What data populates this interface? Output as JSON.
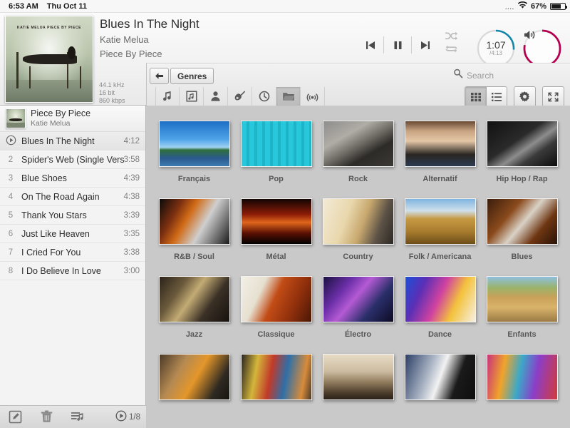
{
  "statusbar": {
    "time": "6:53 AM",
    "date": "Thu Oct 11",
    "signal_dots": "....",
    "wifi_icon": "wifi-icon",
    "battery_percent": "67%"
  },
  "player": {
    "cover_caption": "KATIE MELUA  PIECE BY PIECE",
    "song": "Blues In The Night",
    "artist": "Katie Melua",
    "album": "Piece By Piece",
    "tech": {
      "sample_rate": "44.1 kHz",
      "bit_depth": "16 bit",
      "bitrate": "860 kbps"
    },
    "transport": {
      "previous": "previous-track-icon",
      "play_pause": "pause-icon",
      "next": "next-track-icon",
      "shuffle": "shuffle-icon",
      "repeat": "repeat-icon"
    },
    "progress": {
      "elapsed": "1:07",
      "total": "/4:13",
      "percent": 26,
      "color": "#1387a8"
    },
    "volume": {
      "icon": "speaker-icon",
      "percent": 78,
      "color": "#b3004f"
    }
  },
  "library_toolbar": {
    "back_icon": "back-arrow-icon",
    "breadcrumb": "Genres",
    "search": {
      "icon": "search-icon",
      "placeholder": "Search",
      "value": ""
    },
    "categories": [
      {
        "name": "songs",
        "icon": "music-note-icon",
        "active": false
      },
      {
        "name": "albums",
        "icon": "album-art-icon",
        "active": false
      },
      {
        "name": "artists",
        "icon": "person-icon",
        "active": false
      },
      {
        "name": "composers",
        "icon": "guitar-icon",
        "active": false
      },
      {
        "name": "recent",
        "icon": "clock-icon",
        "active": false
      },
      {
        "name": "genres",
        "icon": "folder-icon",
        "active": true
      },
      {
        "name": "radio",
        "icon": "broadcast-icon",
        "active": false
      }
    ],
    "view_buttons": [
      {
        "name": "grid-view",
        "icon": "grid-icon",
        "active": true
      },
      {
        "name": "list-view",
        "icon": "list-icon",
        "active": false
      }
    ],
    "settings_icon": "gear-icon",
    "fullscreen_icon": "fullscreen-icon"
  },
  "sidebar": {
    "header": {
      "title": "Piece By Piece",
      "artist": "Katie Melua",
      "thumb": "album-thumbnail"
    },
    "tracks": [
      {
        "num": "1",
        "playing": true,
        "name": "Blues In The Night",
        "duration": "4:12"
      },
      {
        "num": "2",
        "playing": false,
        "name": "Spider's Web (Single Version)",
        "duration": "3:58"
      },
      {
        "num": "3",
        "playing": false,
        "name": "Blue Shoes",
        "duration": "4:39"
      },
      {
        "num": "4",
        "playing": false,
        "name": "On The Road Again",
        "duration": "4:38"
      },
      {
        "num": "5",
        "playing": false,
        "name": "Thank You Stars",
        "duration": "3:39"
      },
      {
        "num": "6",
        "playing": false,
        "name": "Just Like Heaven",
        "duration": "3:35"
      },
      {
        "num": "7",
        "playing": false,
        "name": "I Cried For You",
        "duration": "3:38"
      },
      {
        "num": "8",
        "playing": false,
        "name": "I Do Believe In Love",
        "duration": "3:00"
      }
    ],
    "footer": {
      "edit_icon": "edit-icon",
      "delete_icon": "trash-icon",
      "playlist_icon": "add-to-playlist-icon",
      "count": "1/8",
      "count_icon": "play-icon"
    }
  },
  "genres": {
    "rows": [
      [
        {
          "label": "Français",
          "image": "eiffel-tower-photo"
        },
        {
          "label": "Pop",
          "image": "microphone-on-teal-wood-photo"
        },
        {
          "label": "Rock",
          "image": "yellow-guitar-cables-photo"
        },
        {
          "label": "Alternatif",
          "image": "amplifier-knobs-photo"
        },
        {
          "label": "Hip Hop / Rap",
          "image": "boombox-bw-photo"
        }
      ],
      [
        {
          "label": "R&B / Soul",
          "image": "bass-guitar-photo"
        },
        {
          "label": "Métal",
          "image": "concert-crowd-horns-photo"
        },
        {
          "label": "Country",
          "image": "dusty-pickup-truck-photo"
        },
        {
          "label": "Folk / Americana",
          "image": "prairie-fence-photo"
        },
        {
          "label": "Blues",
          "image": "harmonica-acoustic-guitar-photo"
        }
      ],
      [
        {
          "label": "Jazz",
          "image": "saxophone-photo"
        },
        {
          "label": "Classique",
          "image": "violin-sheet-music-photo"
        },
        {
          "label": "Électro",
          "image": "dj-headphones-photo"
        },
        {
          "label": "Dance",
          "image": "dancer-colorful-lights-photo"
        },
        {
          "label": "Enfants",
          "image": "playground-swings-photo"
        }
      ],
      [
        {
          "label": "",
          "image": "world-instruments-photo"
        },
        {
          "label": "",
          "image": "colorful-textile-photo"
        },
        {
          "label": "",
          "image": "djembe-drums-photo"
        },
        {
          "label": "",
          "image": "clapperboard-film-photo"
        },
        {
          "label": "",
          "image": "carnival-colors-photo"
        }
      ]
    ]
  }
}
